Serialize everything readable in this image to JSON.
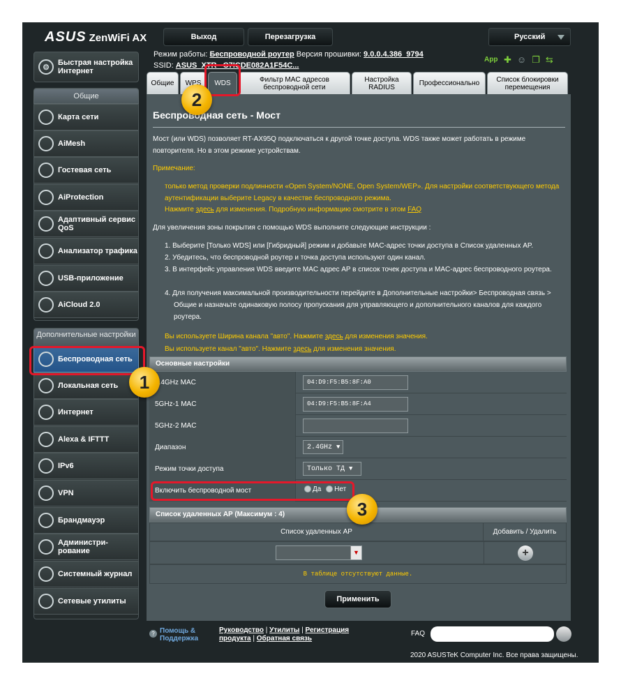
{
  "header": {
    "logo": "ASUS",
    "product": "ZenWiFi AX",
    "logout_label": "Выход",
    "reboot_label": "Перезагрузка",
    "language": "Русский"
  },
  "infobar": {
    "mode_label": "Режим работы:",
    "mode_value": "Беспроводной роутер",
    "fw_label": "Версия прошивки:",
    "fw_value": "9.0.0.4.386_9794",
    "ssid_label": "SSID:",
    "ssid_value": "ASUS_XTR_ C7ICDE082A1F54C...",
    "app_label": "App"
  },
  "sidebar": {
    "quick_setup": "Быстрая настройка Интернет",
    "general_header": "Общие",
    "general_items": [
      {
        "label": "Карта сети",
        "icon": "network-map-icon"
      },
      {
        "label": "AiMesh",
        "icon": "aimesh-icon"
      },
      {
        "label": "Гостевая сеть",
        "icon": "guest-network-icon"
      },
      {
        "label": "AiProtection",
        "icon": "aiprotection-icon"
      },
      {
        "label": "Адаптивный сервис QoS",
        "icon": "qos-icon"
      },
      {
        "label": "Анализатор трафика",
        "icon": "traffic-analyzer-icon"
      },
      {
        "label": "USB-приложение",
        "icon": "usb-icon"
      },
      {
        "label": "AiCloud 2.0",
        "icon": "aicloud-icon"
      }
    ],
    "advanced_header": "Дополнительные настройки",
    "advanced_items": [
      {
        "label": "Беспроводная сеть",
        "icon": "wireless-icon"
      },
      {
        "label": "Локальная сеть",
        "icon": "lan-icon"
      },
      {
        "label": "Интернет",
        "icon": "wan-icon"
      },
      {
        "label": "Alexa & IFTTT",
        "icon": "alexa-icon"
      },
      {
        "label": "IPv6",
        "icon": "ipv6-icon"
      },
      {
        "label": "VPN",
        "icon": "vpn-icon"
      },
      {
        "label": "Брандмауэр",
        "icon": "firewall-icon"
      },
      {
        "label": "Администри-рование",
        "icon": "administration-icon"
      },
      {
        "label": "Системный журнал",
        "icon": "system-log-icon"
      },
      {
        "label": "Сетевые утилиты",
        "icon": "network-tools-icon"
      }
    ]
  },
  "tabs": [
    "Общие",
    "WPS",
    "WDS",
    "Фильтр MAC адресов беспроводной сети",
    "Настройка RADIUS",
    "Профессионально",
    "Список блокировки перемещения"
  ],
  "page": {
    "title": "Беспроводная сеть - Мост",
    "intro": "Мост (или WDS) позволяет RT-AX95Q подключаться к другой точке доступа. WDS также может работать в режиме повторителя. Но в этом режиме устройствам.",
    "note_title": "Примечание:",
    "note_line1": "только метод проверки подлинности «Open System/NONE, Open System/WEP». Для настройки соответствующего метода аутентификации выберите Legacy в качестве беспроводного режима.",
    "note_line2_a": "Нажмите",
    "note_line2_link": "здесь",
    "note_line2_b": "для изменения. Подробную информацию смотрите в этом",
    "note_line2_faq": "FAQ",
    "instructions_intro": "Для увеличения зоны покрытия с помощью WDS выполните следующие инструкции :",
    "steps": [
      "Выберите [Только WDS] или [Гибридный] режим и добавьте MAC-адрес точки доступа в Список удаленных AP.",
      "Убедитесь, что беспроводной роутер и точка доступа используют один канал.",
      "В интерфейс управления WDS введите MAC адрес AP в список точек доступа и MAC-адрес беспроводного роутера.",
      "Для получения максимальной производительности перейдите в Дополнительные настройки> Беспроводная связь > Общие и назначьте одинаковую полосу пропускания для управляющего и дополнительного каналов для каждого роутера."
    ],
    "warn1_a": "Вы используете Ширина канала \"авто\". Нажмите",
    "warn1_link": "здесь",
    "warn1_b": "для изменения значения.",
    "warn2_a": "Вы используете канал \"авто\". Нажмите",
    "warn2_link": "здесь",
    "warn2_b": "для изменения значения."
  },
  "basic": {
    "header": "Основные настройки",
    "rows": [
      {
        "label": "2.4GHz MAC",
        "value": "04:D9:F5:B5:8F:A0"
      },
      {
        "label": "5GHz-1 MAC",
        "value": "04:D9:F5:B5:8F:A4"
      },
      {
        "label": "5GHz-2 MAC",
        "value": ""
      }
    ],
    "band_label": "Диапазон",
    "band_value": "2.4GHz",
    "ap_mode_label": "Режим точки доступа",
    "ap_mode_value": "Только ТД",
    "bridge_label": "Включить беспроводной мост",
    "bridge_yes": "Да",
    "bridge_no": "Нет"
  },
  "remote": {
    "header": "Список удаленных AP (Максимум : 4)",
    "col_list": "Список удаленных AP",
    "col_action": "Добавить / Удалить",
    "empty": "В таблице отсутствуют данные."
  },
  "apply_label": "Применить",
  "footer": {
    "help_a": "Помощь &",
    "help_b": "Поддержка",
    "manual": "Руководство",
    "utilities": "Утилиты",
    "registration_a": "Регистрация",
    "registration_b": "продукта",
    "feedback": "Обратная связь",
    "faq": "FAQ",
    "copyright": "2020 ASUSTeK Computer Inc. Все права защищены."
  },
  "annotations": [
    "1",
    "2",
    "3"
  ],
  "colors": {
    "annotation_red": "#e5182a",
    "badge_yellow": "#f4b400",
    "note_yellow": "#ffcc00",
    "panel": "#4d595d",
    "frame": "#1f2628"
  }
}
